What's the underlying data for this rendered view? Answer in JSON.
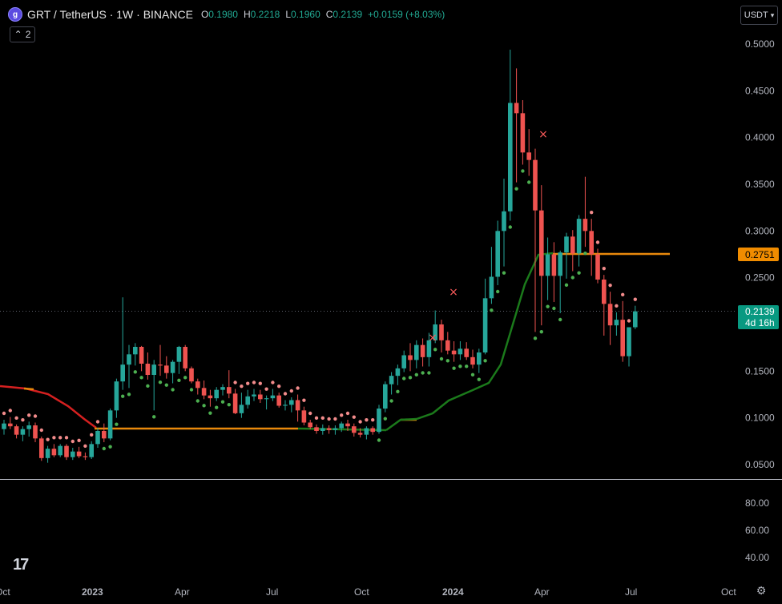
{
  "header": {
    "logo_letter": "g",
    "title": "GRT / TetherUS · 1W · BINANCE",
    "ohlc": [
      {
        "k": "O",
        "v": "0.1980"
      },
      {
        "k": "H",
        "v": "0.2218"
      },
      {
        "k": "L",
        "v": "0.1960"
      },
      {
        "k": "C",
        "v": "0.2139"
      },
      {
        "k": "",
        "v": "+0.0159 (+8.03%)"
      }
    ]
  },
  "indicator_toggle": {
    "count": "2",
    "icon": "chevron-up-icon"
  },
  "currency_button": {
    "label": "USDT",
    "icon": "chevron-down-icon"
  },
  "branding": {
    "logo": "17"
  },
  "colors": {
    "up": "#26a69a",
    "down": "#ef5350",
    "trend_up": "#1b7a1b",
    "trend_down": "#d42020",
    "neutral": "#e8890c",
    "price_label": "#089981",
    "level_label": "#f08c00"
  },
  "chart_data": {
    "type": "candlestick",
    "x": [
      "Oct",
      "2023",
      "Apr",
      "Jul",
      "Oct",
      "2024",
      "Apr",
      "Jul",
      "Oct"
    ],
    "y_ticks_main": [
      "0.5000",
      "0.4500",
      "0.4000",
      "0.3500",
      "0.3000",
      "0.2500",
      "0.1500",
      "0.1000",
      "0.0500"
    ],
    "y_ticks_sub": [
      "80.00",
      "60.00",
      "40.00"
    ],
    "ylim": [
      0.044,
      0.523
    ],
    "price_label": {
      "value": "0.2139",
      "countdown": "4d 16h"
    },
    "level_label": {
      "value": "0.2751"
    },
    "markers": [
      "×",
      "×",
      "×"
    ],
    "candles": [
      [
        0.088,
        0.098,
        0.082,
        0.094
      ],
      [
        0.094,
        0.101,
        0.088,
        0.091
      ],
      [
        0.091,
        0.093,
        0.078,
        0.082
      ],
      [
        0.082,
        0.091,
        0.075,
        0.088
      ],
      [
        0.088,
        0.096,
        0.08,
        0.092
      ],
      [
        0.092,
        0.095,
        0.074,
        0.078
      ],
      [
        0.078,
        0.08,
        0.054,
        0.057
      ],
      [
        0.057,
        0.07,
        0.052,
        0.067
      ],
      [
        0.067,
        0.072,
        0.058,
        0.06
      ],
      [
        0.06,
        0.072,
        0.058,
        0.07
      ],
      [
        0.07,
        0.072,
        0.055,
        0.058
      ],
      [
        0.058,
        0.068,
        0.055,
        0.064
      ],
      [
        0.064,
        0.069,
        0.057,
        0.059
      ],
      [
        0.059,
        0.063,
        0.055,
        0.058
      ],
      [
        0.058,
        0.075,
        0.056,
        0.072
      ],
      [
        0.072,
        0.089,
        0.068,
        0.086
      ],
      [
        0.086,
        0.094,
        0.074,
        0.078
      ],
      [
        0.078,
        0.11,
        0.076,
        0.108
      ],
      [
        0.108,
        0.142,
        0.1,
        0.139
      ],
      [
        0.139,
        0.229,
        0.13,
        0.157
      ],
      [
        0.157,
        0.178,
        0.132,
        0.168
      ],
      [
        0.168,
        0.18,
        0.156,
        0.176
      ],
      [
        0.176,
        0.177,
        0.15,
        0.158
      ],
      [
        0.158,
        0.17,
        0.141,
        0.146
      ],
      [
        0.146,
        0.162,
        0.108,
        0.157
      ],
      [
        0.157,
        0.178,
        0.145,
        0.156
      ],
      [
        0.156,
        0.166,
        0.142,
        0.148
      ],
      [
        0.148,
        0.162,
        0.137,
        0.16
      ],
      [
        0.16,
        0.177,
        0.147,
        0.176
      ],
      [
        0.176,
        0.178,
        0.15,
        0.153
      ],
      [
        0.153,
        0.155,
        0.137,
        0.139
      ],
      [
        0.139,
        0.142,
        0.125,
        0.132
      ],
      [
        0.132,
        0.14,
        0.12,
        0.124
      ],
      [
        0.124,
        0.13,
        0.112,
        0.121
      ],
      [
        0.121,
        0.133,
        0.118,
        0.13
      ],
      [
        0.13,
        0.136,
        0.124,
        0.133
      ],
      [
        0.133,
        0.151,
        0.121,
        0.126
      ],
      [
        0.126,
        0.131,
        0.104,
        0.105
      ],
      [
        0.105,
        0.127,
        0.1,
        0.114
      ],
      [
        0.114,
        0.13,
        0.11,
        0.123
      ],
      [
        0.123,
        0.131,
        0.118,
        0.125
      ],
      [
        0.125,
        0.13,
        0.116,
        0.12
      ],
      [
        0.12,
        0.124,
        0.109,
        0.121
      ],
      [
        0.121,
        0.131,
        0.118,
        0.124
      ],
      [
        0.124,
        0.127,
        0.111,
        0.113
      ],
      [
        0.113,
        0.119,
        0.108,
        0.114
      ],
      [
        0.114,
        0.122,
        0.106,
        0.119
      ],
      [
        0.119,
        0.125,
        0.096,
        0.108
      ],
      [
        0.108,
        0.112,
        0.092,
        0.095
      ],
      [
        0.095,
        0.098,
        0.088,
        0.09
      ],
      [
        0.09,
        0.093,
        0.083,
        0.086
      ],
      [
        0.086,
        0.093,
        0.082,
        0.089
      ],
      [
        0.089,
        0.092,
        0.083,
        0.087
      ],
      [
        0.087,
        0.092,
        0.082,
        0.089
      ],
      [
        0.089,
        0.096,
        0.085,
        0.094
      ],
      [
        0.094,
        0.098,
        0.086,
        0.091
      ],
      [
        0.091,
        0.094,
        0.08,
        0.084
      ],
      [
        0.084,
        0.089,
        0.079,
        0.082
      ],
      [
        0.082,
        0.091,
        0.077,
        0.089
      ],
      [
        0.089,
        0.091,
        0.082,
        0.085
      ],
      [
        0.085,
        0.114,
        0.083,
        0.11
      ],
      [
        0.11,
        0.139,
        0.106,
        0.136
      ],
      [
        0.136,
        0.149,
        0.125,
        0.145
      ],
      [
        0.145,
        0.157,
        0.135,
        0.153
      ],
      [
        0.153,
        0.172,
        0.149,
        0.167
      ],
      [
        0.167,
        0.18,
        0.15,
        0.162
      ],
      [
        0.162,
        0.183,
        0.153,
        0.178
      ],
      [
        0.178,
        0.185,
        0.155,
        0.165
      ],
      [
        0.165,
        0.191,
        0.155,
        0.183
      ],
      [
        0.183,
        0.215,
        0.18,
        0.2
      ],
      [
        0.2,
        0.205,
        0.17,
        0.183
      ],
      [
        0.183,
        0.192,
        0.168,
        0.172
      ],
      [
        0.172,
        0.182,
        0.16,
        0.168
      ],
      [
        0.168,
        0.182,
        0.162,
        0.174
      ],
      [
        0.174,
        0.181,
        0.162,
        0.165
      ],
      [
        0.165,
        0.173,
        0.153,
        0.157
      ],
      [
        0.157,
        0.174,
        0.148,
        0.17
      ],
      [
        0.17,
        0.249,
        0.168,
        0.228
      ],
      [
        0.228,
        0.283,
        0.222,
        0.251
      ],
      [
        0.251,
        0.311,
        0.242,
        0.3
      ],
      [
        0.3,
        0.356,
        0.262,
        0.321
      ],
      [
        0.321,
        0.494,
        0.311,
        0.437
      ],
      [
        0.437,
        0.474,
        0.352,
        0.426
      ],
      [
        0.426,
        0.44,
        0.371,
        0.384
      ],
      [
        0.384,
        0.409,
        0.359,
        0.376
      ],
      [
        0.376,
        0.388,
        0.192,
        0.322
      ],
      [
        0.322,
        0.349,
        0.199,
        0.252
      ],
      [
        0.252,
        0.293,
        0.226,
        0.275
      ],
      [
        0.275,
        0.288,
        0.224,
        0.252
      ],
      [
        0.252,
        0.279,
        0.212,
        0.277
      ],
      [
        0.277,
        0.298,
        0.249,
        0.294
      ],
      [
        0.294,
        0.301,
        0.257,
        0.276
      ],
      [
        0.276,
        0.317,
        0.262,
        0.313
      ],
      [
        0.313,
        0.358,
        0.283,
        0.3
      ],
      [
        0.3,
        0.313,
        0.252,
        0.275
      ],
      [
        0.275,
        0.281,
        0.244,
        0.248
      ],
      [
        0.248,
        0.253,
        0.188,
        0.222
      ],
      [
        0.222,
        0.235,
        0.178,
        0.199
      ],
      [
        0.199,
        0.213,
        0.188,
        0.205
      ],
      [
        0.205,
        0.225,
        0.16,
        0.166
      ],
      [
        0.166,
        0.197,
        0.155,
        0.197
      ],
      [
        0.197,
        0.22,
        0.195,
        0.214
      ]
    ]
  }
}
